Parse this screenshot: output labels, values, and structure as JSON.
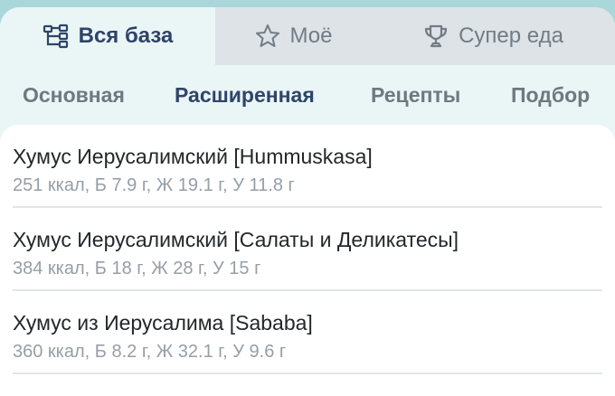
{
  "top_tabs": [
    {
      "label": "Вся база",
      "icon": "hierarchy-icon",
      "active": true
    },
    {
      "label": "Моё",
      "icon": "star-icon",
      "active": false
    },
    {
      "label": "Супер еда",
      "icon": "trophy-icon",
      "active": false
    }
  ],
  "sub_tabs": [
    {
      "label": "Основная",
      "active": false
    },
    {
      "label": "Расширенная",
      "active": true
    },
    {
      "label": "Рецепты",
      "active": false
    },
    {
      "label": "Подбор",
      "active": false
    }
  ],
  "items": [
    {
      "title": "Хумус Иерусалимский [Hummuskasa]",
      "nutrition": "251 ккал, Б 7.9 г, Ж 19.1 г, У 11.8 г"
    },
    {
      "title": "Хумус Иерусалимский [Салаты и Деликатесы]",
      "nutrition": "384 ккал, Б 18 г, Ж 28 г, У 15 г"
    },
    {
      "title": "Хумус из Иерусалима [Sababa]",
      "nutrition": "360 ккал, Б 8.2 г, Ж 32.1 г, У 9.6 г"
    }
  ],
  "colors": {
    "accent": "#2f4469",
    "background": "#eaf5f6",
    "inactive_tab": "#dde3e7"
  }
}
